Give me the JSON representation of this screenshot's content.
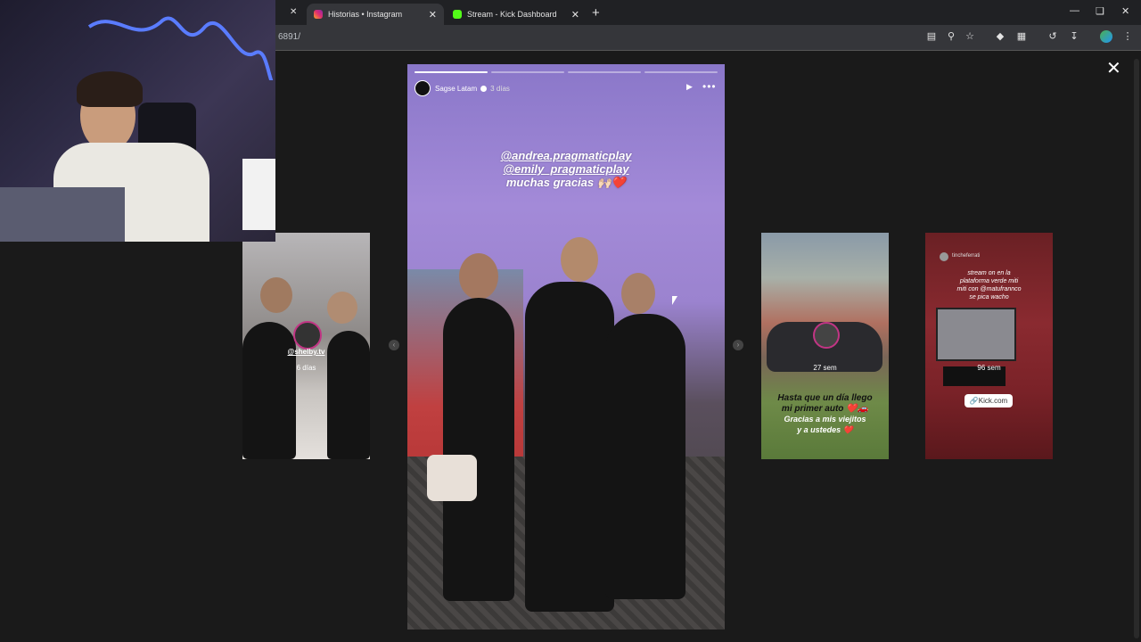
{
  "browser": {
    "tabs": [
      {
        "label": "Historias • Instagram",
        "active": true,
        "icon": "instagram-icon"
      },
      {
        "label": "Stream - Kick Dashboard",
        "active": false,
        "icon": "kick-icon"
      }
    ],
    "url": "6891/",
    "close_glyph": "✕",
    "new_tab_glyph": "+"
  },
  "viewer": {
    "close_glyph": "✕",
    "main_story": {
      "username": "Sagse Latam",
      "time_ago": "3 días",
      "caption_lines": [
        "@andrea.pragmaticplay",
        "@emily_pragmaticplay",
        "muchas gracias 🙌🏻❤️"
      ],
      "progress_segments": 4,
      "progress_done": 1
    },
    "left_story": {
      "mention": "@shelby.tv",
      "time_ago": "6 días"
    },
    "right_story_1": {
      "time_ago": "27 sem",
      "text_lines": [
        "Hasta que un día llego",
        "mi primer auto ❤️🚗",
        "Gracias a mis viejitos",
        "y a ustedes ❤️"
      ]
    },
    "right_story_2": {
      "username": "tincheferrati",
      "text_lines": [
        "stream on en la",
        "plataforma verde miti",
        "miti con @matufrannco",
        "se pica wacho"
      ],
      "time_ago": "96 sem",
      "link_label": "Kick.com"
    }
  },
  "colors": {
    "accent_instagram": "#e1306c",
    "accent_kick": "#53fc18",
    "story_purple": "#9b83cf"
  }
}
